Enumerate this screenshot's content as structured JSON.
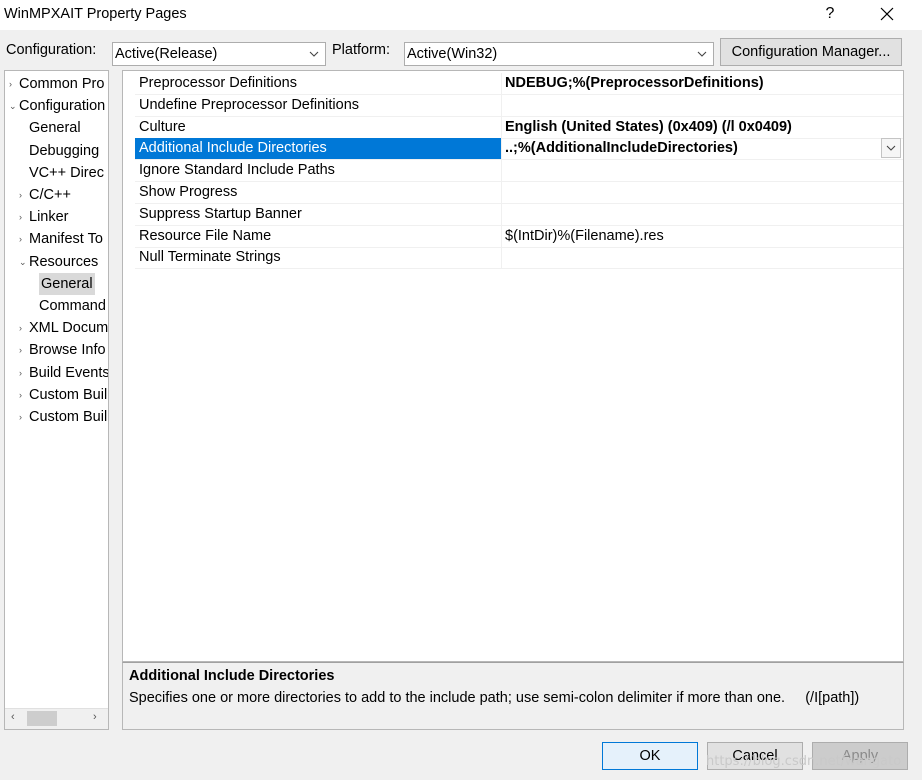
{
  "window": {
    "title": "WinMPXAIT Property Pages",
    "help": "?",
    "close_icon": "close-icon"
  },
  "config": {
    "configuration_label": "Configuration:",
    "configuration_value": "Active(Release)",
    "platform_label": "Platform:",
    "platform_value": "Active(Win32)",
    "manager_button": "Configuration Manager..."
  },
  "tree": {
    "items": [
      {
        "label": "Common Pro",
        "arrow": "›",
        "level": 0
      },
      {
        "label": "Configuration",
        "arrow": "⌄",
        "level": 0
      },
      {
        "label": "General",
        "arrow": "",
        "level": 1
      },
      {
        "label": "Debugging",
        "arrow": "",
        "level": 1
      },
      {
        "label": "VC++ Direc",
        "arrow": "",
        "level": 1
      },
      {
        "label": "C/C++",
        "arrow": "›",
        "level": 1
      },
      {
        "label": "Linker",
        "arrow": "›",
        "level": 1
      },
      {
        "label": "Manifest To",
        "arrow": "›",
        "level": 1
      },
      {
        "label": "Resources",
        "arrow": "⌄",
        "level": 1
      },
      {
        "label": "General",
        "arrow": "",
        "level": 2,
        "selected": true
      },
      {
        "label": "Command",
        "arrow": "",
        "level": 2
      },
      {
        "label": "XML Docum",
        "arrow": "›",
        "level": 1
      },
      {
        "label": "Browse Info",
        "arrow": "›",
        "level": 1
      },
      {
        "label": "Build Events",
        "arrow": "›",
        "level": 1
      },
      {
        "label": "Custom Buil",
        "arrow": "›",
        "level": 1
      },
      {
        "label": "Custom Buil",
        "arrow": "›",
        "level": 1
      }
    ],
    "scroll_left": "‹",
    "scroll_right": "›"
  },
  "properties": [
    {
      "name": "Preprocessor Definitions",
      "value": "NDEBUG;%(PreprocessorDefinitions)",
      "bold": true
    },
    {
      "name": "Undefine Preprocessor Definitions",
      "value": "",
      "bold": false
    },
    {
      "name": "Culture",
      "value": "English (United States) (0x409) (/l 0x0409)",
      "bold": true
    },
    {
      "name": "Additional Include Directories",
      "value": "..;%(AdditionalIncludeDirectories)",
      "bold": true,
      "selected": true
    },
    {
      "name": "Ignore Standard Include Paths",
      "value": "",
      "bold": false
    },
    {
      "name": "Show Progress",
      "value": "",
      "bold": false
    },
    {
      "name": "Suppress Startup Banner",
      "value": "",
      "bold": false
    },
    {
      "name": "Resource File Name",
      "value": "$(IntDir)%(Filename).res",
      "bold": false
    },
    {
      "name": "Null Terminate Strings",
      "value": "",
      "bold": false
    }
  ],
  "description": {
    "title": "Additional Include Directories",
    "text": "Specifies one or more directories to add to the include path; use semi-colon delimiter if more than one.     (/I[path])"
  },
  "buttons": {
    "ok": "OK",
    "cancel": "Cancel",
    "apply": "Apply"
  },
  "watermark": "https://blog.csdn.net/wangato",
  "colors": {
    "selection": "#0078d7",
    "tree_selection": "#d9d9d9"
  }
}
